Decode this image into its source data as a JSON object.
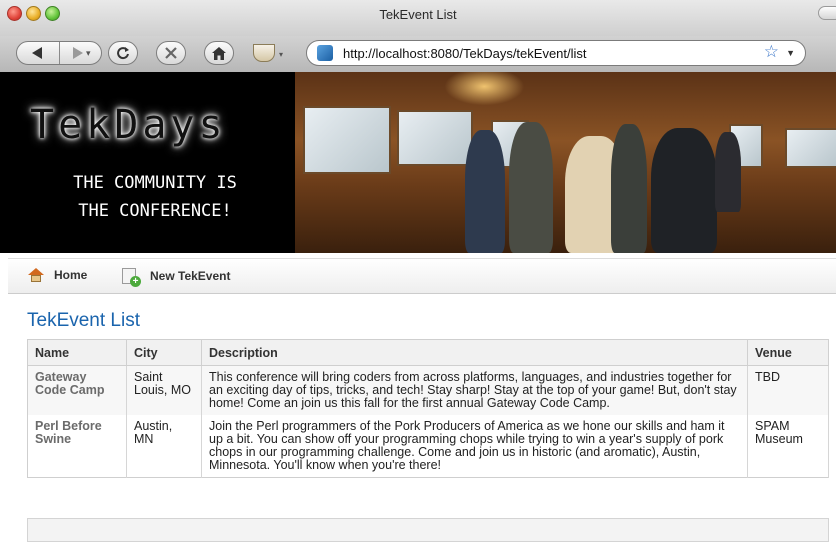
{
  "window": {
    "title": "TekEvent List"
  },
  "toolbar": {
    "url": "http://localhost:8080/TekDays/tekEvent/list",
    "back_icon": "back-arrow-icon",
    "forward_icon": "forward-arrow-icon",
    "reload_icon": "reload-icon",
    "stop_icon": "stop-icon",
    "home_icon": "home-icon",
    "bookmark_icon": "star-icon"
  },
  "banner": {
    "logo": "TekDays",
    "tagline_line1": "THE COMMUNITY IS",
    "tagline_line2": "THE CONFERENCE!"
  },
  "nav": {
    "home_label": "Home",
    "new_label": "New TekEvent"
  },
  "main": {
    "title": "TekEvent List",
    "columns": [
      "Name",
      "City",
      "Description",
      "Venue"
    ],
    "rows": [
      {
        "name": "Gateway Code Camp",
        "city": "Saint Louis, MO",
        "description": "This conference will bring coders from across platforms, languages, and industries together for an exciting day of tips, tricks, and tech! Stay sharp! Stay at the top of your game! But, don't stay home! Come an join us this fall for the first annual Gateway Code Camp.",
        "venue": "TBD"
      },
      {
        "name": "Perl Before Swine",
        "city": "Austin, MN",
        "description": "Join the Perl programmers of the Pork Producers of America as we hone our skills and ham it up a bit. You can show off your programming chops while trying to win a year's supply of pork chops in our programming challenge. Come and join us in historic (and aromatic), Austin, Minnesota. You'll know when you're there!",
        "venue": "SPAM Museum"
      }
    ]
  },
  "colors": {
    "link_blue": "#1a64ad",
    "banner_bg": "#000000"
  }
}
